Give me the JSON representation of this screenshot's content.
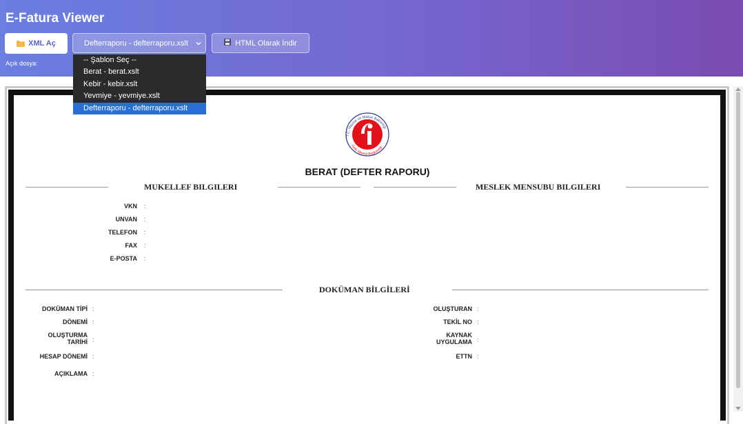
{
  "app": {
    "title": "E-Fatura Viewer"
  },
  "toolbar": {
    "open_xml_label": "XML Aç",
    "template_selected": "Defterraporu - defterraporu.xslt",
    "download_label": "HTML Olarak İndir",
    "open_file_label": "Açık dosya:"
  },
  "dropdown": {
    "options": [
      "-- Şablon Seç --",
      "Berat - berat.xslt",
      "Kebir - kebir.xslt",
      "Yevmiye - yevmiye.xslt",
      "Defterraporu - defterraporu.xslt"
    ],
    "selected_index": 4
  },
  "colors": {
    "header_start": "#6a7fe0",
    "header_end": "#7a4cb0",
    "dropdown_bg": "#2b2b2b",
    "dropdown_selected": "#2a6fd6",
    "logo_red": "#e3121a",
    "logo_blue": "#2b3a8f"
  },
  "document": {
    "logo_text_top": "T.C. Hazine ve Maliye Bakanlığı",
    "logo_text_bottom": "Gelir İdaresi Başkanlığı",
    "title": "BERAT (DEFTER RAPORU)",
    "sections": {
      "mukellef": "MUKELLEF BILGILERI",
      "meslek": "MESLEK MENSUBU BILGILERI",
      "dokuman": "DOKÜMAN BİLGİLERİ"
    },
    "mukellef_fields": [
      "VKN",
      "UNVAN",
      "TELEFON",
      "FAX",
      "E-POSTA"
    ],
    "dokuman_left_fields": [
      "DOKÜMAN TİPİ",
      "DÖNEMİ",
      "OLUŞTURMA TARİHİ",
      "HESAP DÖNEMİ",
      "AÇIKLAMA"
    ],
    "dokuman_right_fields": [
      "OLUŞTURAN",
      "TEKİL NO",
      "KAYNAK UYGULAMA",
      "ETTN"
    ],
    "colon": ":"
  }
}
